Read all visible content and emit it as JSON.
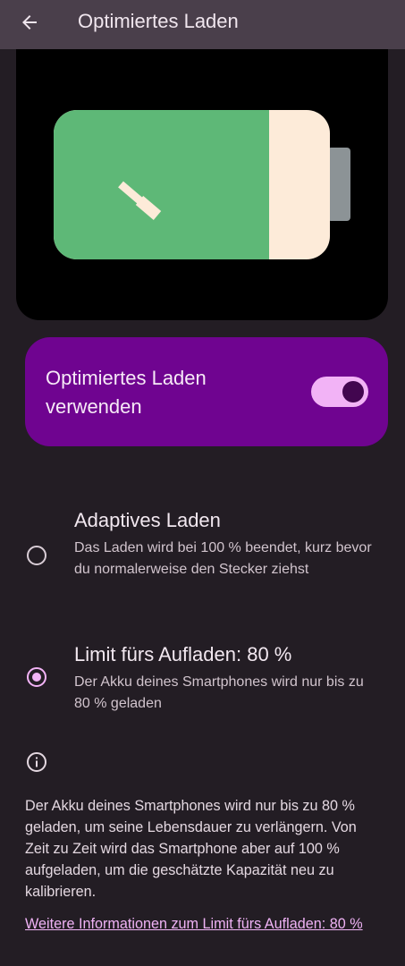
{
  "header": {
    "title": "Optimiertes Laden",
    "back_icon": "arrow-back-icon"
  },
  "battery_illustration": {
    "icon": "battery-charging-icon",
    "charge_level": 0.78,
    "colors": {
      "filled": "#5eb877",
      "empty": "#fdebd9",
      "terminal": "#8c9396",
      "bolt": "#fdebd9",
      "background": "#000000"
    }
  },
  "main_toggle": {
    "label": "Optimiertes Laden verwenden",
    "checked": true,
    "colors": {
      "card": "#6f0490",
      "track": "#f2b3f6",
      "thumb": "#42064f"
    }
  },
  "options": [
    {
      "title": "Adaptives Laden",
      "description": "Das Laden wird bei 100 % beendet, kurz bevor du normalerweise den Stecker ziehst",
      "selected": false
    },
    {
      "title": "Limit fürs Aufladen: 80 %",
      "description": "Der Akku deines Smartphones wird nur bis zu 80 % geladen",
      "selected": true
    }
  ],
  "info": {
    "icon": "info-icon",
    "text": "Der Akku deines Smartphones wird nur bis zu 80 % geladen, um seine Lebensdauer zu verlängern. Von Zeit zu Zeit wird das Smartphone aber auf 100 % aufgeladen, um die geschätzte Kapazität neu zu kalibrieren.",
    "link": "Weitere Informationen zum Limit fürs Aufladen: 80 %"
  },
  "accent_color": "#f2b3f6"
}
